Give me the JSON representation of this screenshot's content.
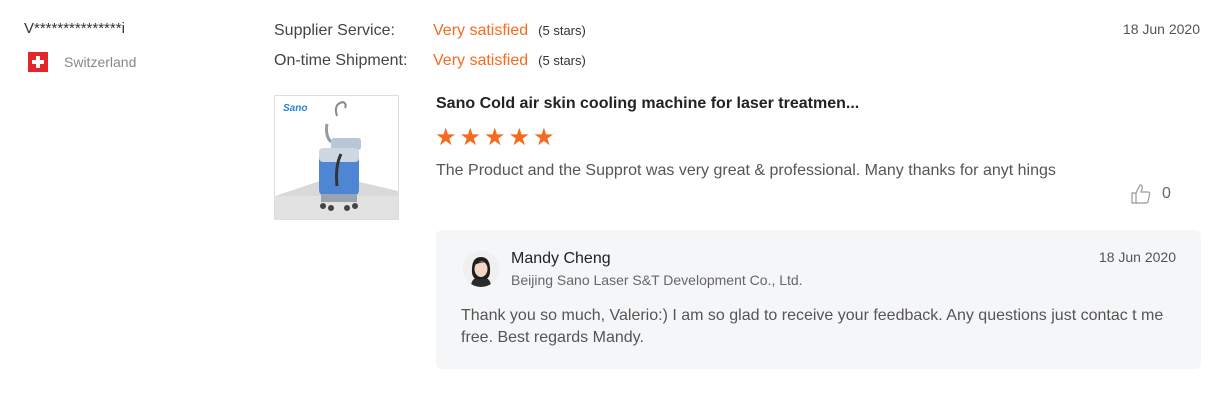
{
  "reviewer": {
    "name": "V***************i",
    "country": "Switzerland"
  },
  "ratings": [
    {
      "label": "Supplier Service:",
      "value": "Very satisfied",
      "stars_text": "(5 stars)"
    },
    {
      "label": "On-time Shipment:",
      "value": "Very satisfied",
      "stars_text": "(5 stars)"
    }
  ],
  "review": {
    "date": "18 Jun 2020",
    "product_title": "Sano Cold air skin cooling machine for laser treatmen...",
    "product_logo_text": "Sano",
    "rating": 5,
    "text": "The Product and the Supprot was very great & professional. Many thanks for anyt hings",
    "likes": "0"
  },
  "reply": {
    "name": "Mandy Cheng",
    "company": "Beijing Sano Laser S&T Development Co., Ltd.",
    "date": "18 Jun 2020",
    "text": "Thank you so much, Valerio:) I am so glad to receive your feedback. Any questions just contac t me free. Best regards Mandy."
  },
  "icons": {
    "flag": "swiss-flag-icon",
    "star": "star-icon",
    "like": "thumbs-up-icon",
    "avatar": "avatar"
  },
  "colors": {
    "accent": "#f56b1e",
    "reply_bg": "#f5f6f8",
    "flag_red": "#e4262b"
  }
}
